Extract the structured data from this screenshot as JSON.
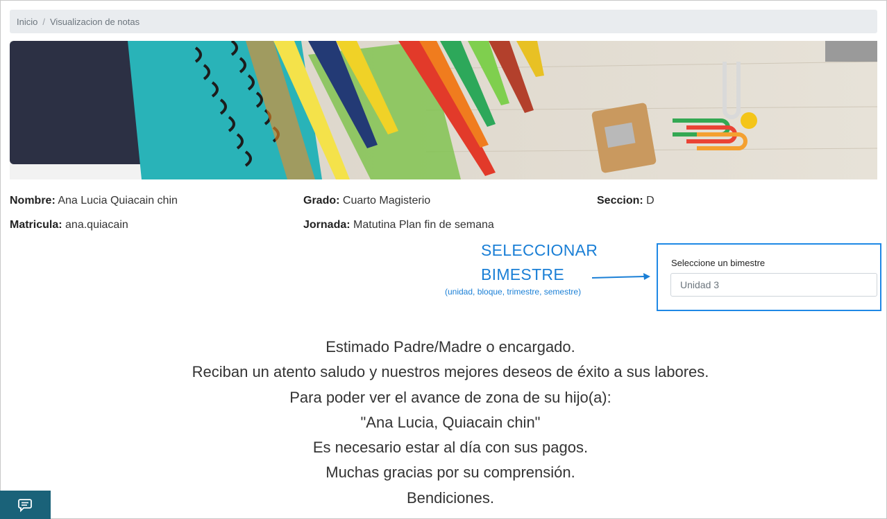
{
  "breadcrumb": {
    "home": "Inicio",
    "separator": "/",
    "current": "Visualizacion de notas"
  },
  "banner": {
    "description_icon": "school-supplies-banner"
  },
  "student": {
    "name_label": "Nombre:",
    "name_value": "Ana Lucia Quiacain chin",
    "grade_label": "Grado:",
    "grade_value": "Cuarto Magisterio",
    "section_label": "Seccion:",
    "section_value": "D",
    "enrollment_label": "Matricula:",
    "enrollment_value": "ana.quiacain",
    "schedule_label": "Jornada:",
    "schedule_value": "Matutina Plan fin de semana"
  },
  "annotation": {
    "line1": "SELECCIONAR",
    "line2": "BIMESTRE",
    "subtitle": "(unidad, bloque, trimestre, semestre)",
    "color": "#1a7fd6"
  },
  "period_select": {
    "label": "Seleccione un bimestre",
    "value": "Unidad 3"
  },
  "message": {
    "lines": [
      "Estimado Padre/Madre o encargado.",
      "Reciban un atento saludo y nuestros mejores deseos de éxito a sus labores.",
      "Para poder ver el avance de zona de su hijo(a):",
      "\"Ana Lucia, Quiacain chin\"",
      "Es necesario estar al día con sus pagos.",
      "Muchas gracias por su comprensión.",
      "Bendiciones."
    ]
  },
  "chat_button": {
    "icon": "chat-icon",
    "color": "#1a6279"
  }
}
